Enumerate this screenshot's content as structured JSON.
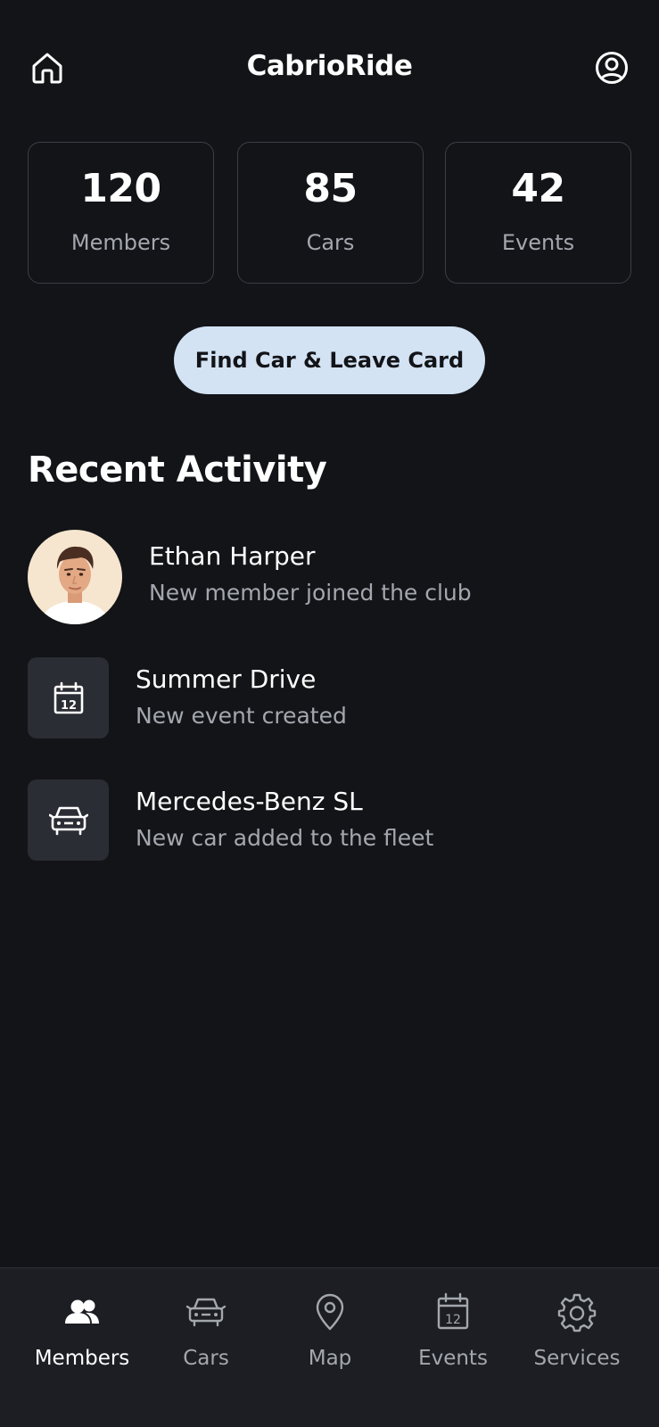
{
  "header": {
    "title": "CabrioRide",
    "home_icon": "home-icon",
    "profile_icon": "user-circle-icon"
  },
  "stats": [
    {
      "value": "120",
      "label": "Members"
    },
    {
      "value": "85",
      "label": "Cars"
    },
    {
      "value": "42",
      "label": "Events"
    }
  ],
  "cta": {
    "label": "Find Car & Leave Card"
  },
  "recent_activity": {
    "title": "Recent Activity",
    "items": [
      {
        "name": "Ethan Harper",
        "description": "New member joined the club",
        "icon": "avatar"
      },
      {
        "name": "Summer Drive",
        "description": "New event created",
        "icon": "calendar-icon"
      },
      {
        "name": "Mercedes-Benz SL",
        "description": "New car added to the fleet",
        "icon": "car-icon"
      }
    ]
  },
  "calendar_icon_day": "12",
  "bottom_nav": {
    "items": [
      {
        "label": "Members",
        "icon": "members-icon",
        "active": true
      },
      {
        "label": "Cars",
        "icon": "car-icon",
        "active": false
      },
      {
        "label": "Map",
        "icon": "map-pin-icon",
        "active": false
      },
      {
        "label": "Events",
        "icon": "calendar-icon",
        "active": false
      },
      {
        "label": "Services",
        "icon": "gear-icon",
        "active": false
      }
    ]
  },
  "colors": {
    "background": "#131418",
    "card_border": "#3b3e44",
    "accent_button": "#d3e3f4",
    "muted_text": "#a3a7ae",
    "tile": "#2a2d33",
    "navbar": "#1c1e23"
  }
}
